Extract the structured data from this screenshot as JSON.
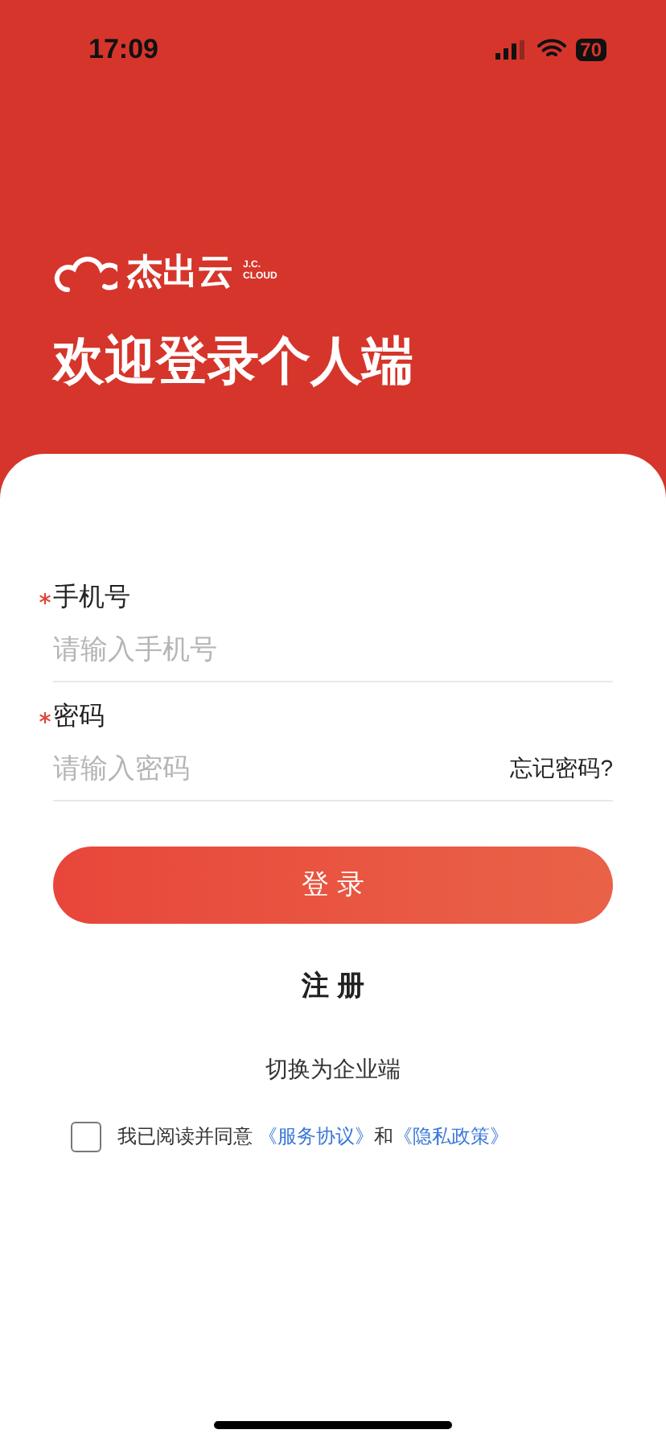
{
  "status_bar": {
    "time": "17:09",
    "battery": "70"
  },
  "brand": {
    "name": "杰出云",
    "tag_line_1": "J.C.",
    "tag_line_2": "CLOUD"
  },
  "title": "欢迎登录个人端",
  "fields": [
    {
      "label": "手机号",
      "required": true,
      "placeholder": "请输入手机号"
    },
    {
      "label": "密码",
      "required": true,
      "placeholder": "请输入密码",
      "link": "忘记密码?"
    }
  ],
  "login_button": "登 录",
  "register_button": "注 册",
  "switch_link": "切换为企业端",
  "agreement": {
    "checked": false,
    "text": "我已阅读并同意",
    "link_1": "《服务协议》",
    "joiner": "和",
    "link_2": "《隐私政策》"
  }
}
